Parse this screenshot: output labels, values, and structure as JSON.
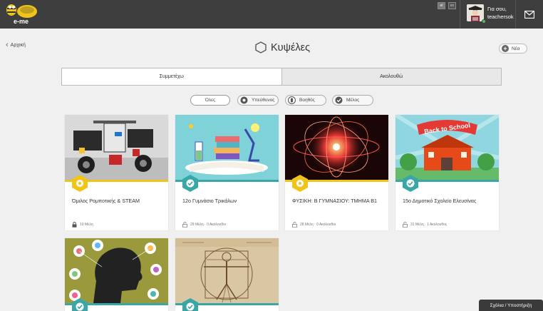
{
  "header": {
    "logo_text": "e-me",
    "languages": [
      "el",
      "en"
    ],
    "greeting_line1": "Για σου,",
    "greeting_line2": "teachersok"
  },
  "nav": {
    "back_label": "Αρχική"
  },
  "page": {
    "title": "Κυψέλες",
    "new_button": "Νέα"
  },
  "tabs": [
    {
      "label": "Συμμετέχω",
      "active": true
    },
    {
      "label": "Ακολουθώ",
      "active": false
    }
  ],
  "filters": [
    {
      "label": "Όλες",
      "icon": "none",
      "active": true
    },
    {
      "label": "Υπεύθυνος",
      "icon": "gear-icon"
    },
    {
      "label": "Βοηθός",
      "icon": "hand-icon"
    },
    {
      "label": "Μέλος",
      "icon": "check-icon"
    }
  ],
  "cards": [
    {
      "title": "Όμιλος Ρομποτικής & STEAM",
      "meta": "10 Μέλη",
      "role": "owner",
      "role_color": "#f0c419",
      "locked": true,
      "image": "robotics"
    },
    {
      "title": "12ο Γυμνάσιο Τρικάλων",
      "meta": "29 Μέλη · 0 Ακόλουθοι",
      "role": "member",
      "role_color": "#3aa6a6",
      "locked": false,
      "image": "science-books"
    },
    {
      "title": "ΦΥΣΙΚΗ: Β ΓΥΜΝΑΣΙΟΥ: ΤΜΗΜΑ Β1",
      "meta": "28 Μέλη · 0 Ακόλουθοι",
      "role": "owner",
      "role_color": "#f0c419",
      "locked": false,
      "image": "physics-particles"
    },
    {
      "title": "15ο Δημοτικό Σχολείο Ελευσίνας",
      "meta": "31 Μέλη · 1 Ακόλουθος",
      "role": "member",
      "role_color": "#3aa6a6",
      "locked": false,
      "image": "back-to-school",
      "image_text": "Back to School"
    },
    {
      "title": "",
      "meta": "",
      "role": "member",
      "role_color": "#3aa6a6",
      "locked": false,
      "image": "head-silhouette"
    },
    {
      "title": "",
      "meta": "",
      "role": "member",
      "role_color": "#3aa6a6",
      "locked": false,
      "image": "vitruvian"
    }
  ],
  "footer": {
    "help_label": "Σχόλια / Υποστήριξη"
  }
}
